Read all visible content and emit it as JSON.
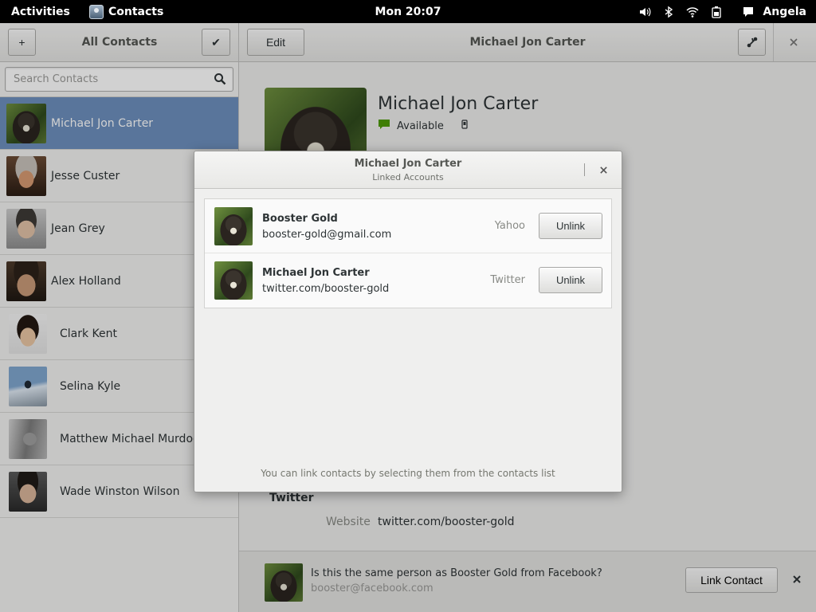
{
  "topbar": {
    "activities": "Activities",
    "app_name": "Contacts",
    "clock": "Mon 20:07",
    "user": "Angela",
    "icons": [
      "volume-icon",
      "bluetooth-icon",
      "wifi-icon",
      "battery-icon",
      "chat-icon"
    ]
  },
  "sidebar": {
    "add_label": "+",
    "title": "All Contacts",
    "select_label": "✔",
    "search_placeholder": "Search Contacts",
    "contacts": [
      {
        "name": "Michael Jon Carter"
      },
      {
        "name": "Jesse Custer"
      },
      {
        "name": "Jean Grey"
      },
      {
        "name": "Alex Holland"
      },
      {
        "name": "Clark Kent"
      },
      {
        "name": "Selina Kyle"
      },
      {
        "name": "Matthew Michael Murdock"
      },
      {
        "name": "Wade Winston Wilson"
      }
    ]
  },
  "detail": {
    "edit_label": "Edit",
    "title": "Michael Jon Carter",
    "name": "Michael Jon Carter",
    "status": "Available",
    "section_title": "Twitter",
    "website_label": "Website",
    "website_value": "twitter.com/booster-gold"
  },
  "suggestion": {
    "question": "Is this the same person as Booster Gold from Facebook?",
    "email": "booster@facebook.com",
    "link_label": "Link Contact"
  },
  "dialog": {
    "title": "Michael Jon Carter",
    "subtitle": "Linked Accounts",
    "accounts": [
      {
        "name": "Booster Gold",
        "id": "booster-gold@gmail.com",
        "service": "Yahoo",
        "action": "Unlink"
      },
      {
        "name": "Michael Jon Carter",
        "id": "twitter.com/booster-gold",
        "service": "Twitter",
        "action": "Unlink"
      }
    ],
    "hint": "You can link contacts by selecting them from the contacts list"
  },
  "colors": {
    "selection": "#6d8fbd",
    "topbar": "#000000",
    "status_available": "#4e9a06"
  }
}
